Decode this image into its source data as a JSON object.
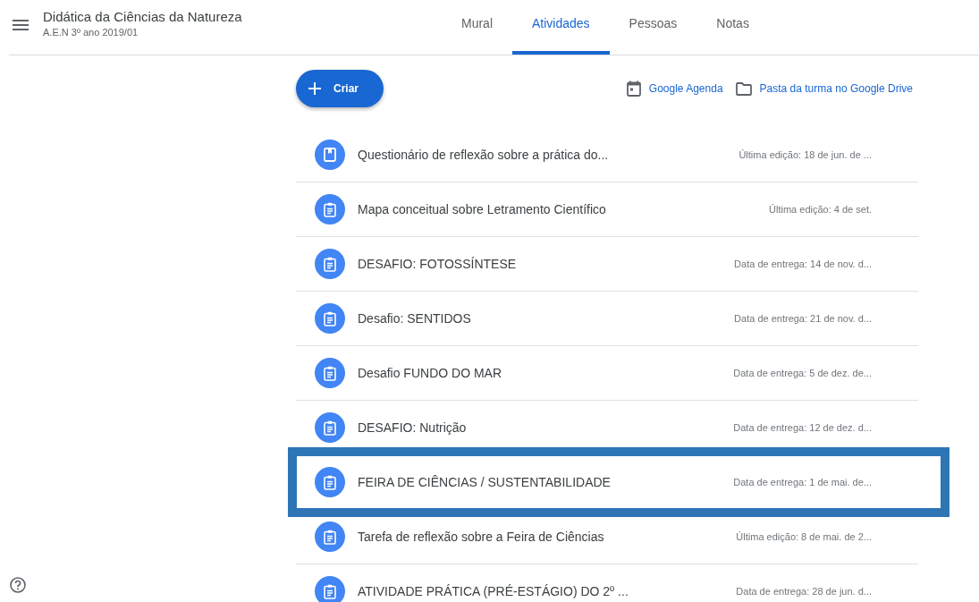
{
  "header": {
    "title": "Didática da Ciências da Natureza",
    "subtitle": "A.E.N 3º ano 2019/01"
  },
  "tabs": [
    {
      "label": "Mural",
      "selected": false
    },
    {
      "label": "Atividades",
      "selected": true
    },
    {
      "label": "Pessoas",
      "selected": false
    },
    {
      "label": "Notas",
      "selected": false
    }
  ],
  "create_button": {
    "label": "Criar"
  },
  "links": [
    {
      "kind": "calendar",
      "label": "Google Agenda"
    },
    {
      "kind": "folder",
      "label": "Pasta da turma no Google Drive"
    }
  ],
  "activities": [
    {
      "kind": "question",
      "title": "Questionário de reflexão sobre a prática do...",
      "meta": "Última edição: 18 de jun. de ...",
      "highlighted": false
    },
    {
      "kind": "assignment",
      "title": "Mapa conceitual sobre Letramento Científico",
      "meta": "Última edição: 4 de set.",
      "highlighted": false
    },
    {
      "kind": "assignment",
      "title": "DESAFIO: FOTOSSÍNTESE",
      "meta": "Data de entrega: 14 de nov. d...",
      "highlighted": false
    },
    {
      "kind": "assignment",
      "title": "Desafio: SENTIDOS",
      "meta": "Data de entrega: 21 de nov. d...",
      "highlighted": false
    },
    {
      "kind": "assignment",
      "title": "Desafio FUNDO DO MAR",
      "meta": "Data de entrega: 5 de dez. de...",
      "highlighted": false
    },
    {
      "kind": "assignment",
      "title": "DESAFIO: Nutrição",
      "meta": "Data de entrega: 12 de dez. d...",
      "highlighted": false
    },
    {
      "kind": "assignment",
      "title": "FEIRA DE CIÊNCIAS / SUSTENTABILIDADE",
      "meta": "Data de entrega: 1 de mai. de...",
      "highlighted": true
    },
    {
      "kind": "assignment",
      "title": "Tarefa de reflexão sobre a Feira de Ciências",
      "meta": "Última edição: 8 de mai. de 2...",
      "highlighted": false
    },
    {
      "kind": "assignment",
      "title": "ATIVIDADE PRÁTICA (PRÉ-ESTÁGIO) DO 2º ...",
      "meta": "Data de entrega: 28 de jun. d...",
      "highlighted": false
    }
  ]
}
